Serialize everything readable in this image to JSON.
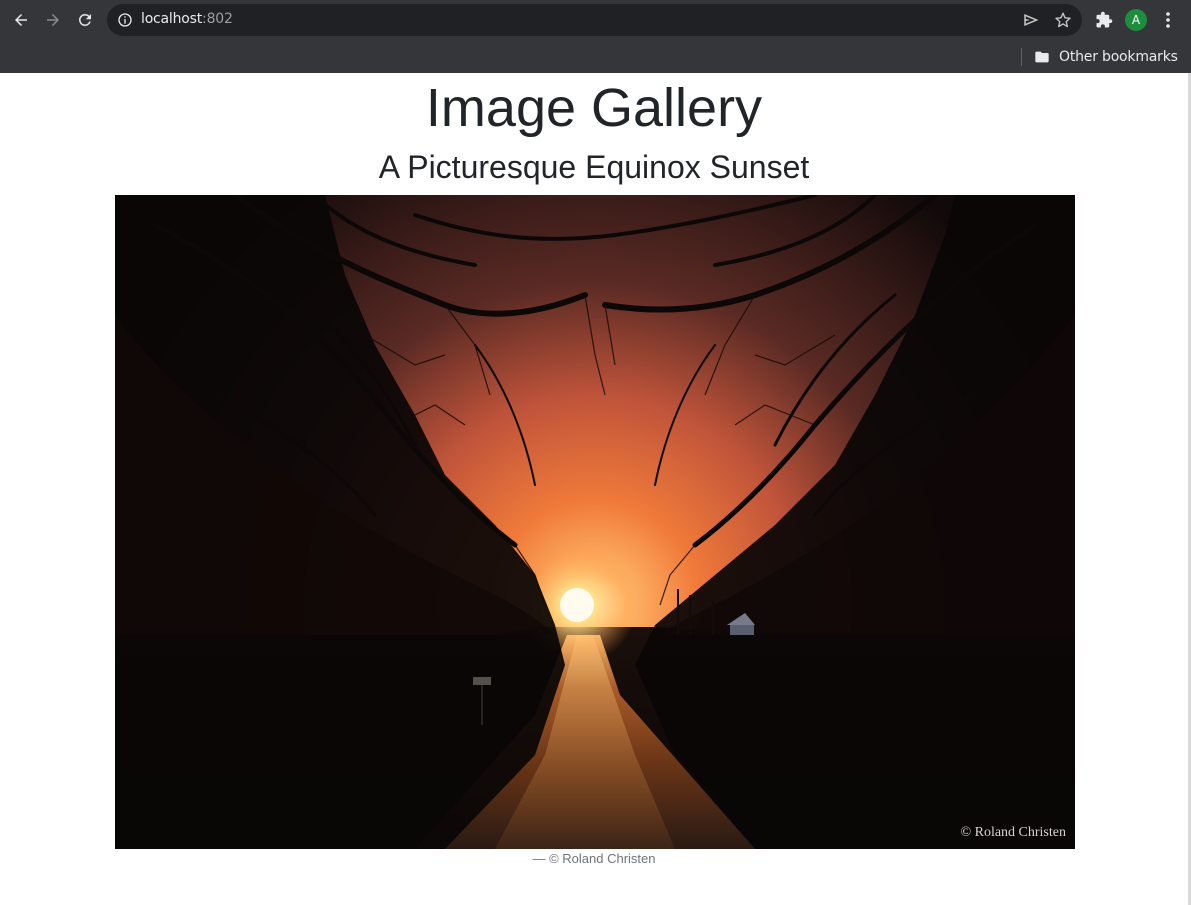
{
  "browser": {
    "url_host": "localhost",
    "url_port": ":802",
    "avatar_letter": "A",
    "bookmarks_folder_label": "Other bookmarks",
    "icons": {
      "back": "arrow-left-icon",
      "forward": "arrow-right-icon",
      "reload": "reload-icon",
      "site_info": "info-icon",
      "send": "send-icon",
      "star": "star-icon",
      "extensions": "puzzle-icon",
      "menu": "kebab-menu-icon",
      "folder": "folder-icon"
    }
  },
  "page": {
    "title": "Image Gallery",
    "subtitle": "A Picturesque Equinox Sunset",
    "image_watermark": "© Roland Christen",
    "caption": "— © Roland Christen"
  },
  "colors": {
    "chrome_bg": "#35363a",
    "omnibox_bg": "#202124",
    "avatar_bg": "#1e8e3e",
    "heading_text": "#212529",
    "caption_text": "#6c757d",
    "sun": "#fff6d8",
    "sky_glow": "#f07a3a"
  }
}
